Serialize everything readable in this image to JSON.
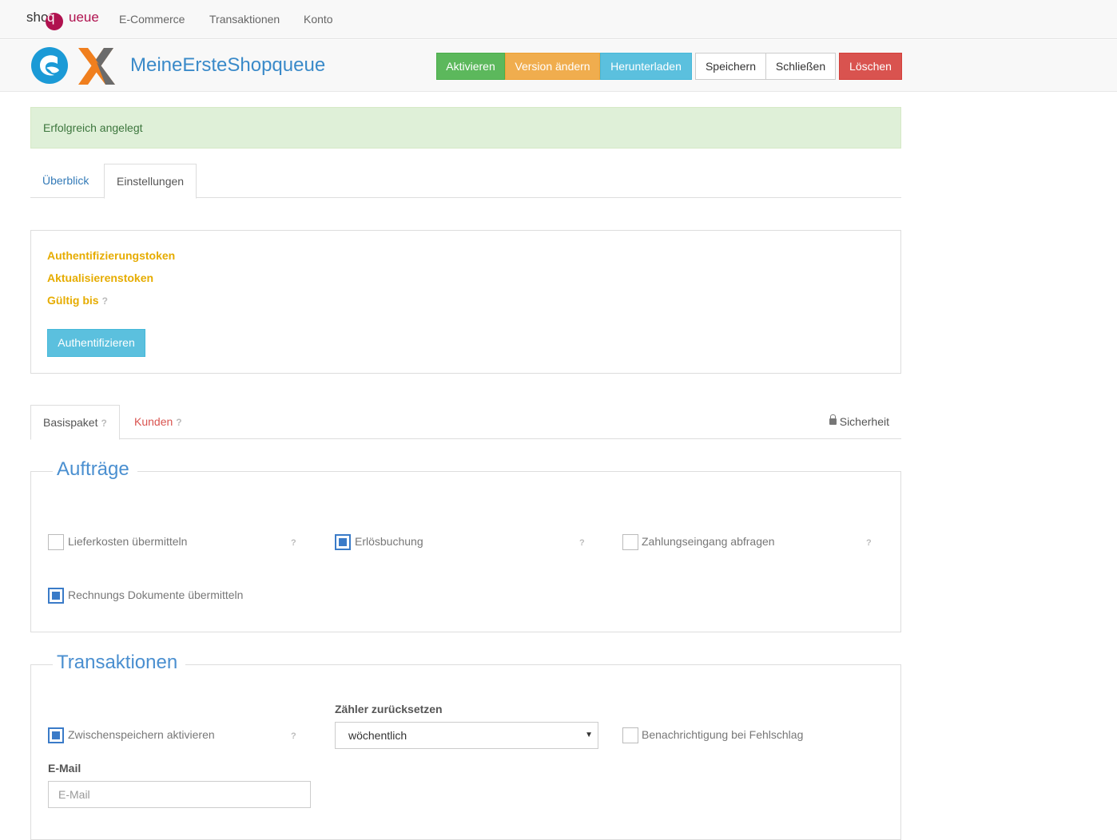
{
  "navbar": {
    "brand_shop": "shop",
    "brand_q": "q",
    "brand_queue": "ueue",
    "links": [
      "E-Commerce",
      "Transaktionen",
      "Konto"
    ]
  },
  "header": {
    "title": "MeineErsteShopqueue",
    "buttons": {
      "activate": "Aktivieren",
      "change_version": "Version ändern",
      "download": "Herunterladen",
      "save": "Speichern",
      "close": "Schließen",
      "delete": "Löschen"
    }
  },
  "alert": {
    "message": "Erfolgreich angelegt"
  },
  "main_tabs": [
    "Überblick",
    "Einstellungen"
  ],
  "auth_panel": {
    "auth_token_label": "Authentifizierungstoken",
    "refresh_token_label": "Aktualisierenstoken",
    "valid_until_label": "Gültig bis",
    "help": "?",
    "authenticate_button": "Authentifizieren"
  },
  "settings_tabs": {
    "basic": "Basispaket",
    "customers": "Kunden",
    "security": "Sicherheit",
    "help": "?"
  },
  "orders": {
    "legend": "Aufträge",
    "options": [
      {
        "label": "Lieferkosten übermitteln",
        "checked": false
      },
      {
        "label": "Erlösbuchung",
        "checked": true
      },
      {
        "label": "Zahlungseingang abfragen",
        "checked": false
      },
      {
        "label": "Rechnungs Dokumente übermitteln",
        "checked": true
      }
    ],
    "help": "?"
  },
  "transactions": {
    "legend": "Transaktionen",
    "cache": {
      "label": "Zwischenspeichern aktivieren",
      "checked": true
    },
    "reset_counter": {
      "label": "Zähler zurücksetzen",
      "value": "wöchentlich"
    },
    "notify": {
      "label": "Benachrichtigung bei Fehlschlag",
      "checked": false
    },
    "email": {
      "label": "E-Mail",
      "placeholder": "E-Mail",
      "value": ""
    },
    "help": "?"
  },
  "colors": {
    "brand": "#b0124f",
    "primary": "#337ab7",
    "success": "#5cb85c",
    "warning": "#f0ad4e",
    "info": "#5bc0de",
    "danger": "#d9534f",
    "token_label": "#e6ac00"
  }
}
